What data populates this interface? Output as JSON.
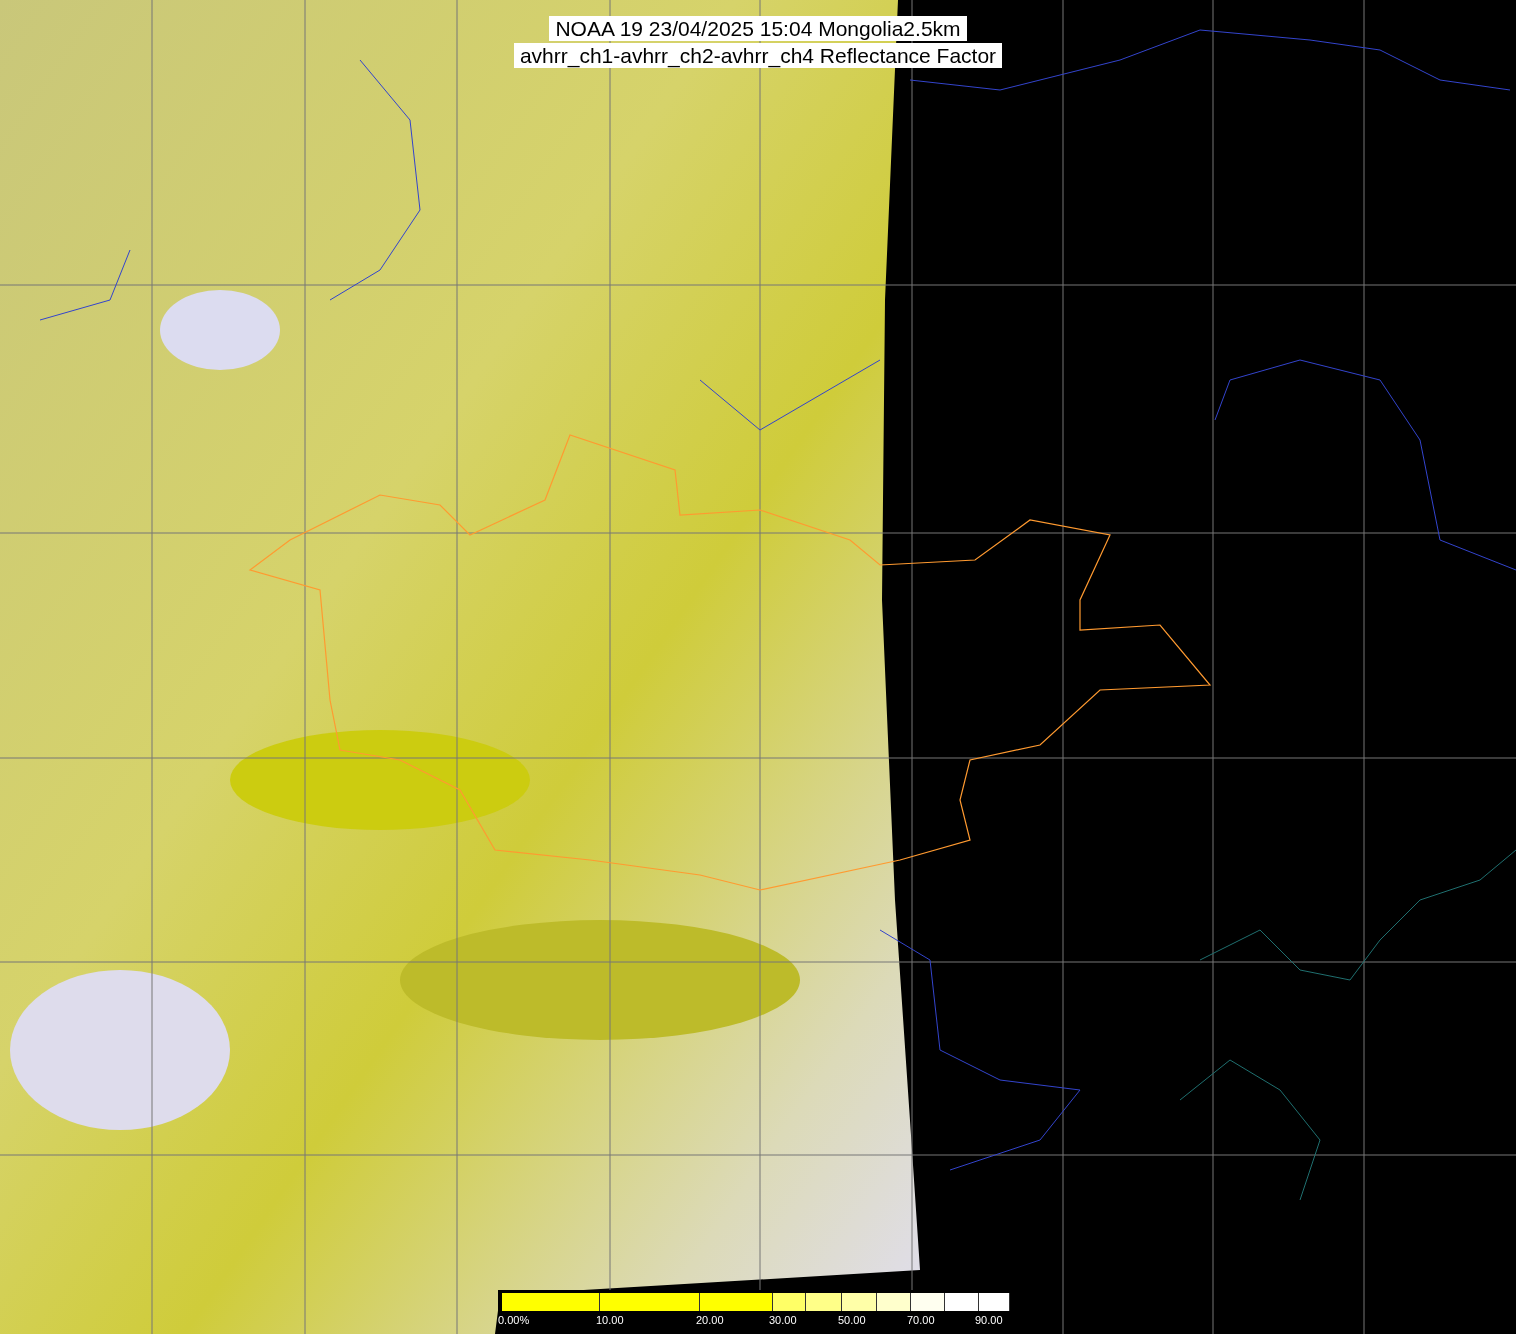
{
  "title_lines": [
    "NOAA 19 23/04/2025 15:04 Mongolia2.5km",
    "avhrr_ch1-avhrr_ch2-avhrr_ch4 Reflectance Factor"
  ],
  "colorbar": {
    "segments": [
      {
        "color": "#ffff00"
      },
      {
        "color": "#ffff00"
      },
      {
        "color": "#ffff00"
      },
      {
        "color": "#ffff66"
      },
      {
        "color": "#ffff88"
      },
      {
        "color": "#ffffa8"
      },
      {
        "color": "#ffffcc"
      },
      {
        "color": "#fffff0"
      },
      {
        "color": "#ffffff"
      },
      {
        "color": "#ffffff"
      }
    ],
    "labels": [
      "0.00%",
      "10.00",
      "20.00",
      "30.00",
      "50.00",
      "70.00",
      "90.00"
    ]
  }
}
